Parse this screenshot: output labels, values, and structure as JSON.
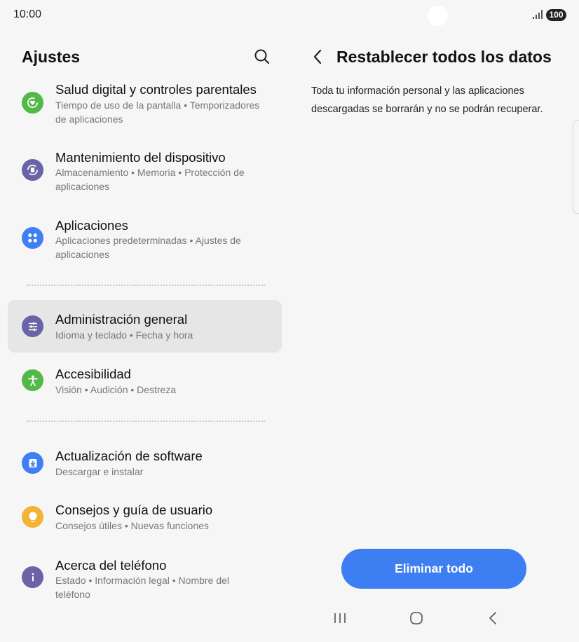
{
  "status_bar": {
    "time": "10:00",
    "battery": "100",
    "signal_icon": "signal-icon"
  },
  "left_pane": {
    "title": "Ajustes",
    "search_icon": "search-icon",
    "items": [
      {
        "title": "Salud digital y controles parentales",
        "subtitle": "Tiempo de uso de la pantalla • Temporizadores de aplicaciones",
        "icon": "digital-wellbeing-icon",
        "color": "#52b848"
      },
      {
        "title": "Mantenimiento del dispositivo",
        "subtitle": "Almacenamiento • Memoria • Protección de aplicaciones",
        "icon": "device-care-icon",
        "color": "#6a63a8"
      },
      {
        "title": "Aplicaciones",
        "subtitle": "Aplicaciones predeterminadas • Ajustes de aplicaciones",
        "icon": "apps-icon",
        "color": "#3f7ef3"
      },
      {
        "title": "Administración general",
        "subtitle": "Idioma y teclado • Fecha y hora",
        "icon": "sliders-icon",
        "color": "#6a63a8"
      },
      {
        "title": "Accesibilidad",
        "subtitle": "Visión • Audición • Destreza",
        "icon": "accessibility-icon",
        "color": "#52b848"
      },
      {
        "title": "Actualización de software",
        "subtitle": "Descargar e instalar",
        "icon": "download-icon",
        "color": "#3f7ef3"
      },
      {
        "title": "Consejos y guía de usuario",
        "subtitle": "Consejos útiles • Nuevas funciones",
        "icon": "lightbulb-icon",
        "color": "#f5b335"
      },
      {
        "title": "Acerca del teléfono",
        "subtitle": "Estado • Información legal • Nombre del teléfono",
        "icon": "info-icon",
        "color": "#6a63a8"
      }
    ]
  },
  "right_pane": {
    "title": "Restablecer todos los datos",
    "description": "Toda tu información personal y las aplicaciones descargadas se borrarán y no se podrán recuperar.",
    "button_label": "Eliminar todo"
  }
}
